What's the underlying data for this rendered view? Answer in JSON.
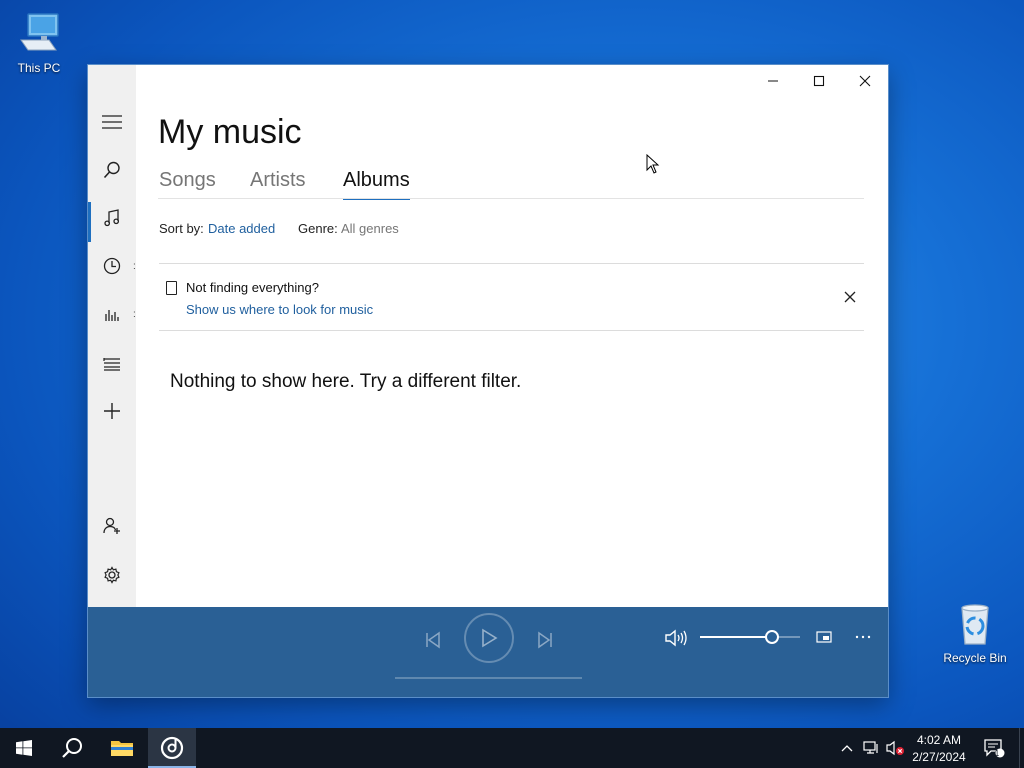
{
  "desktop": {
    "icons": [
      {
        "label": "This PC",
        "icon": "computer-icon"
      },
      {
        "label": "Recycle Bin",
        "icon": "recycle-bin-icon"
      }
    ]
  },
  "app": {
    "title": "My music",
    "tabs": [
      {
        "label": "Songs",
        "active": false
      },
      {
        "label": "Artists",
        "active": false
      },
      {
        "label": "Albums",
        "active": true
      }
    ],
    "sort_label": "Sort by:",
    "sort_value": "Date added",
    "genre_label": "Genre:",
    "genre_value": "All genres",
    "notice": {
      "title": "Not finding everything?",
      "link": "Show us where to look for music"
    },
    "empty_message": "Nothing to show here. Try a different filter.",
    "sidebar": [
      {
        "icon": "hamburger-menu-icon"
      },
      {
        "icon": "search-icon"
      },
      {
        "icon": "music-note-icon",
        "active": true
      },
      {
        "icon": "clock-icon"
      },
      {
        "icon": "bar-chart-icon"
      },
      {
        "icon": "playlist-icon"
      },
      {
        "icon": "plus-icon"
      },
      {
        "icon": "add-user-icon"
      },
      {
        "icon": "gear-icon"
      }
    ],
    "accent_color": "#1e6fbf",
    "player_color": "#2a6095",
    "volume_level": 0.72
  },
  "taskbar": {
    "time": "4:02 AM",
    "date": "2/27/2024",
    "notification_count": "1"
  }
}
